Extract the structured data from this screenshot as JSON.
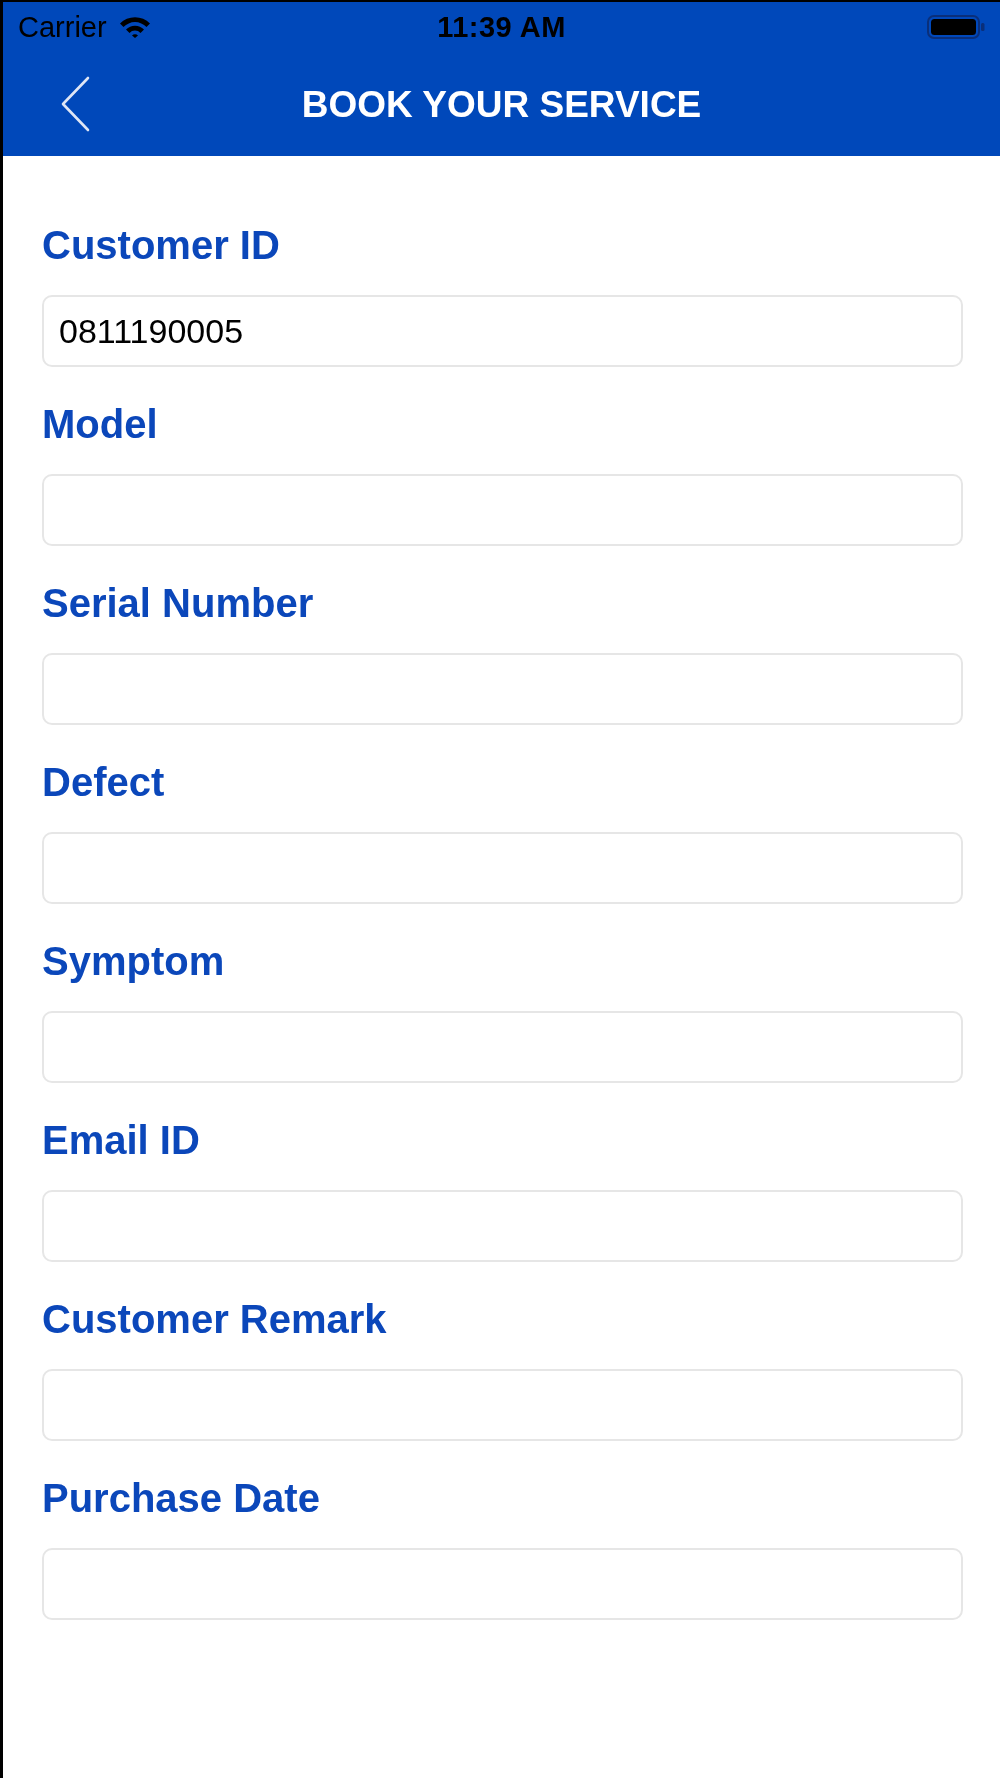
{
  "status_bar": {
    "carrier": "Carrier",
    "time": "11:39 AM"
  },
  "header": {
    "title": "BOOK YOUR SERVICE"
  },
  "form": {
    "fields": [
      {
        "label": "Customer ID",
        "value": "0811190005"
      },
      {
        "label": "Model"
      },
      {
        "label": "Serial Number"
      },
      {
        "label": "Defect"
      },
      {
        "label": "Symptom"
      },
      {
        "label": "Email ID"
      },
      {
        "label": "Customer Remark"
      },
      {
        "label": "Purchase Date"
      }
    ]
  }
}
